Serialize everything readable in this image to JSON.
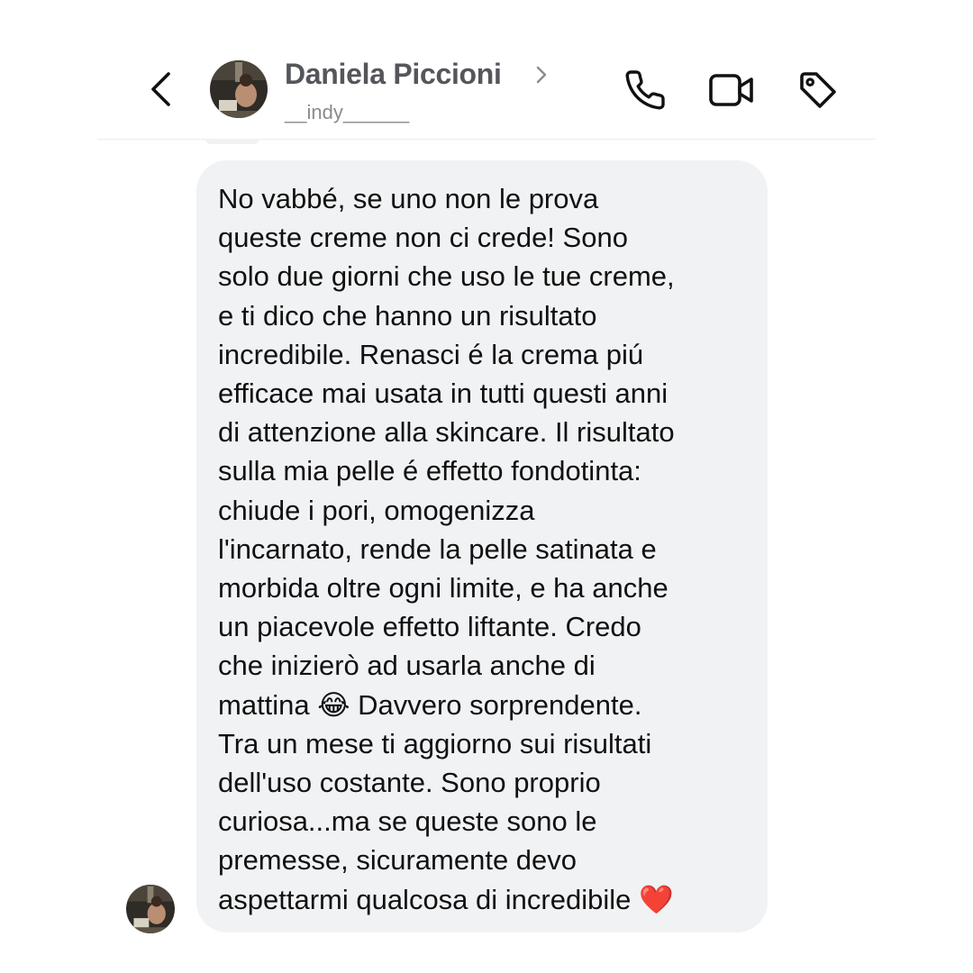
{
  "header": {
    "contact_name": "Daniela Piccioni",
    "contact_handle": "__indy______",
    "icons": {
      "back": "chevron-left-icon",
      "profile": "chevron-right-icon",
      "call": "phone-icon",
      "video": "video-camera-icon",
      "tag": "tag-icon"
    }
  },
  "message": {
    "text": "No vabbé, se uno non le prova\nqueste creme non ci crede! Sono\nsolo due giorni che uso le tue creme,\ne ti dico che hanno un risultato\nincredibile. Renasci é la crema piú\nefficace mai usata in tutti questi anni\ndi attenzione alla skincare. Il risultato\nsulla mia pelle é effetto fondotinta:\nchiude i pori, omogenizza\nl'incarnato, rende la pelle satinata e\nmorbida oltre ogni limite, e ha anche\nun piacevole effetto liftante. Credo\nche inizierò ad usarla anche di\nmattina 😂 Davvero sorprendente.\nTra un mese ti aggiorno sui risultati\ndell'uso costante. Sono proprio\ncuriosa...ma se queste sono le\npremesse, sicuramente devo\naspettarmi qualcosa di incredibile ❤️"
  },
  "colors": {
    "bubble_bg": "#f1f2f4",
    "name_text": "#55565b",
    "handle_text": "#8a8b90",
    "icon": "#111111"
  }
}
